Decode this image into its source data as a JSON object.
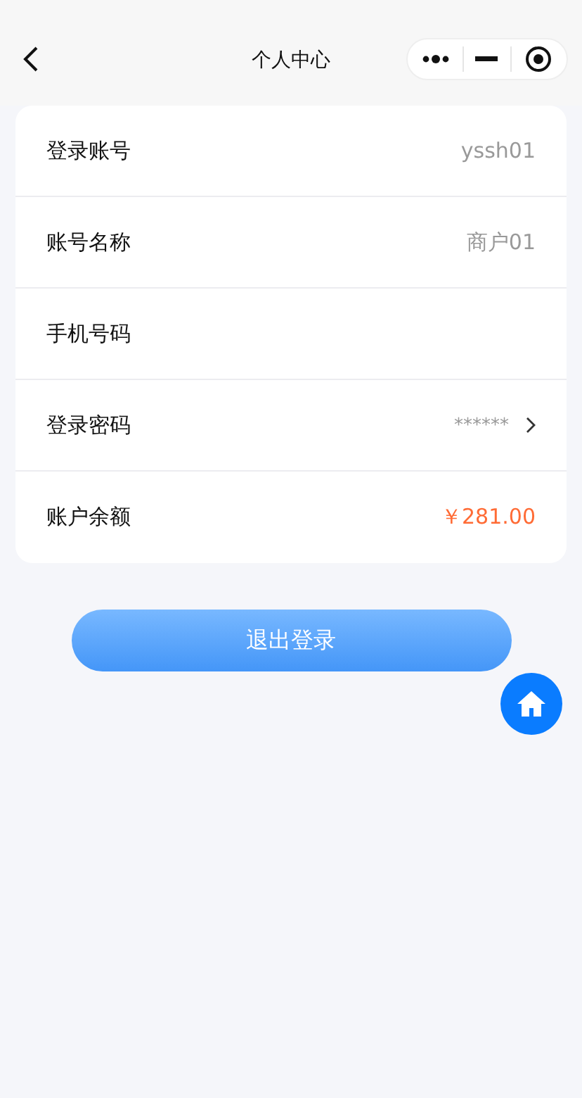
{
  "nav": {
    "title": "个人中心"
  },
  "rows": [
    {
      "label": "登录账号",
      "value": "yssh01",
      "kind": "text"
    },
    {
      "label": "账号名称",
      "value": "商户01",
      "kind": "text"
    },
    {
      "label": "手机号码",
      "kind": "text"
    },
    {
      "label": "登录密码",
      "value": "******",
      "kind": "link"
    },
    {
      "label": "账户余额",
      "value": "￥281.00",
      "kind": "amount"
    }
  ],
  "logout_button": "退出登录"
}
